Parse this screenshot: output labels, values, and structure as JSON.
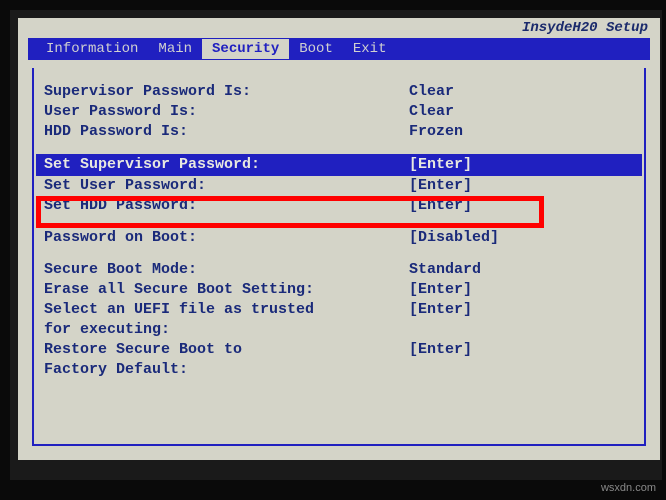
{
  "header": {
    "brand": "InsydeH20 Setup"
  },
  "menu": {
    "items": [
      "Information",
      "Main",
      "Security",
      "Boot",
      "Exit"
    ],
    "active_index": 2
  },
  "security": {
    "status": [
      {
        "label": "Supervisor Password Is:",
        "value": "Clear"
      },
      {
        "label": "User Password Is:",
        "value": "Clear"
      },
      {
        "label": "HDD Password Is:",
        "value": "Frozen"
      }
    ],
    "set_pw": [
      {
        "label": "Set Supervisor Password:",
        "value": "[Enter]"
      },
      {
        "label": "Set User Password:",
        "value": "[Enter]"
      },
      {
        "label": "Set HDD Password:",
        "value": "[Enter]"
      }
    ],
    "boot_pw": {
      "label": "Password on Boot:",
      "value": "[Disabled]"
    },
    "secure": [
      {
        "label": "Secure Boot Mode:",
        "value": "Standard"
      },
      {
        "label": "Erase all Secure Boot Setting:",
        "value": "[Enter]"
      },
      {
        "label": "Select an UEFI file as trusted",
        "value": "[Enter]"
      },
      {
        "label": "for executing:",
        "value": ""
      },
      {
        "label": "Restore Secure Boot to",
        "value": "[Enter]"
      },
      {
        "label": "Factory Default:",
        "value": ""
      }
    ]
  },
  "watermark": "wsxdn.com"
}
